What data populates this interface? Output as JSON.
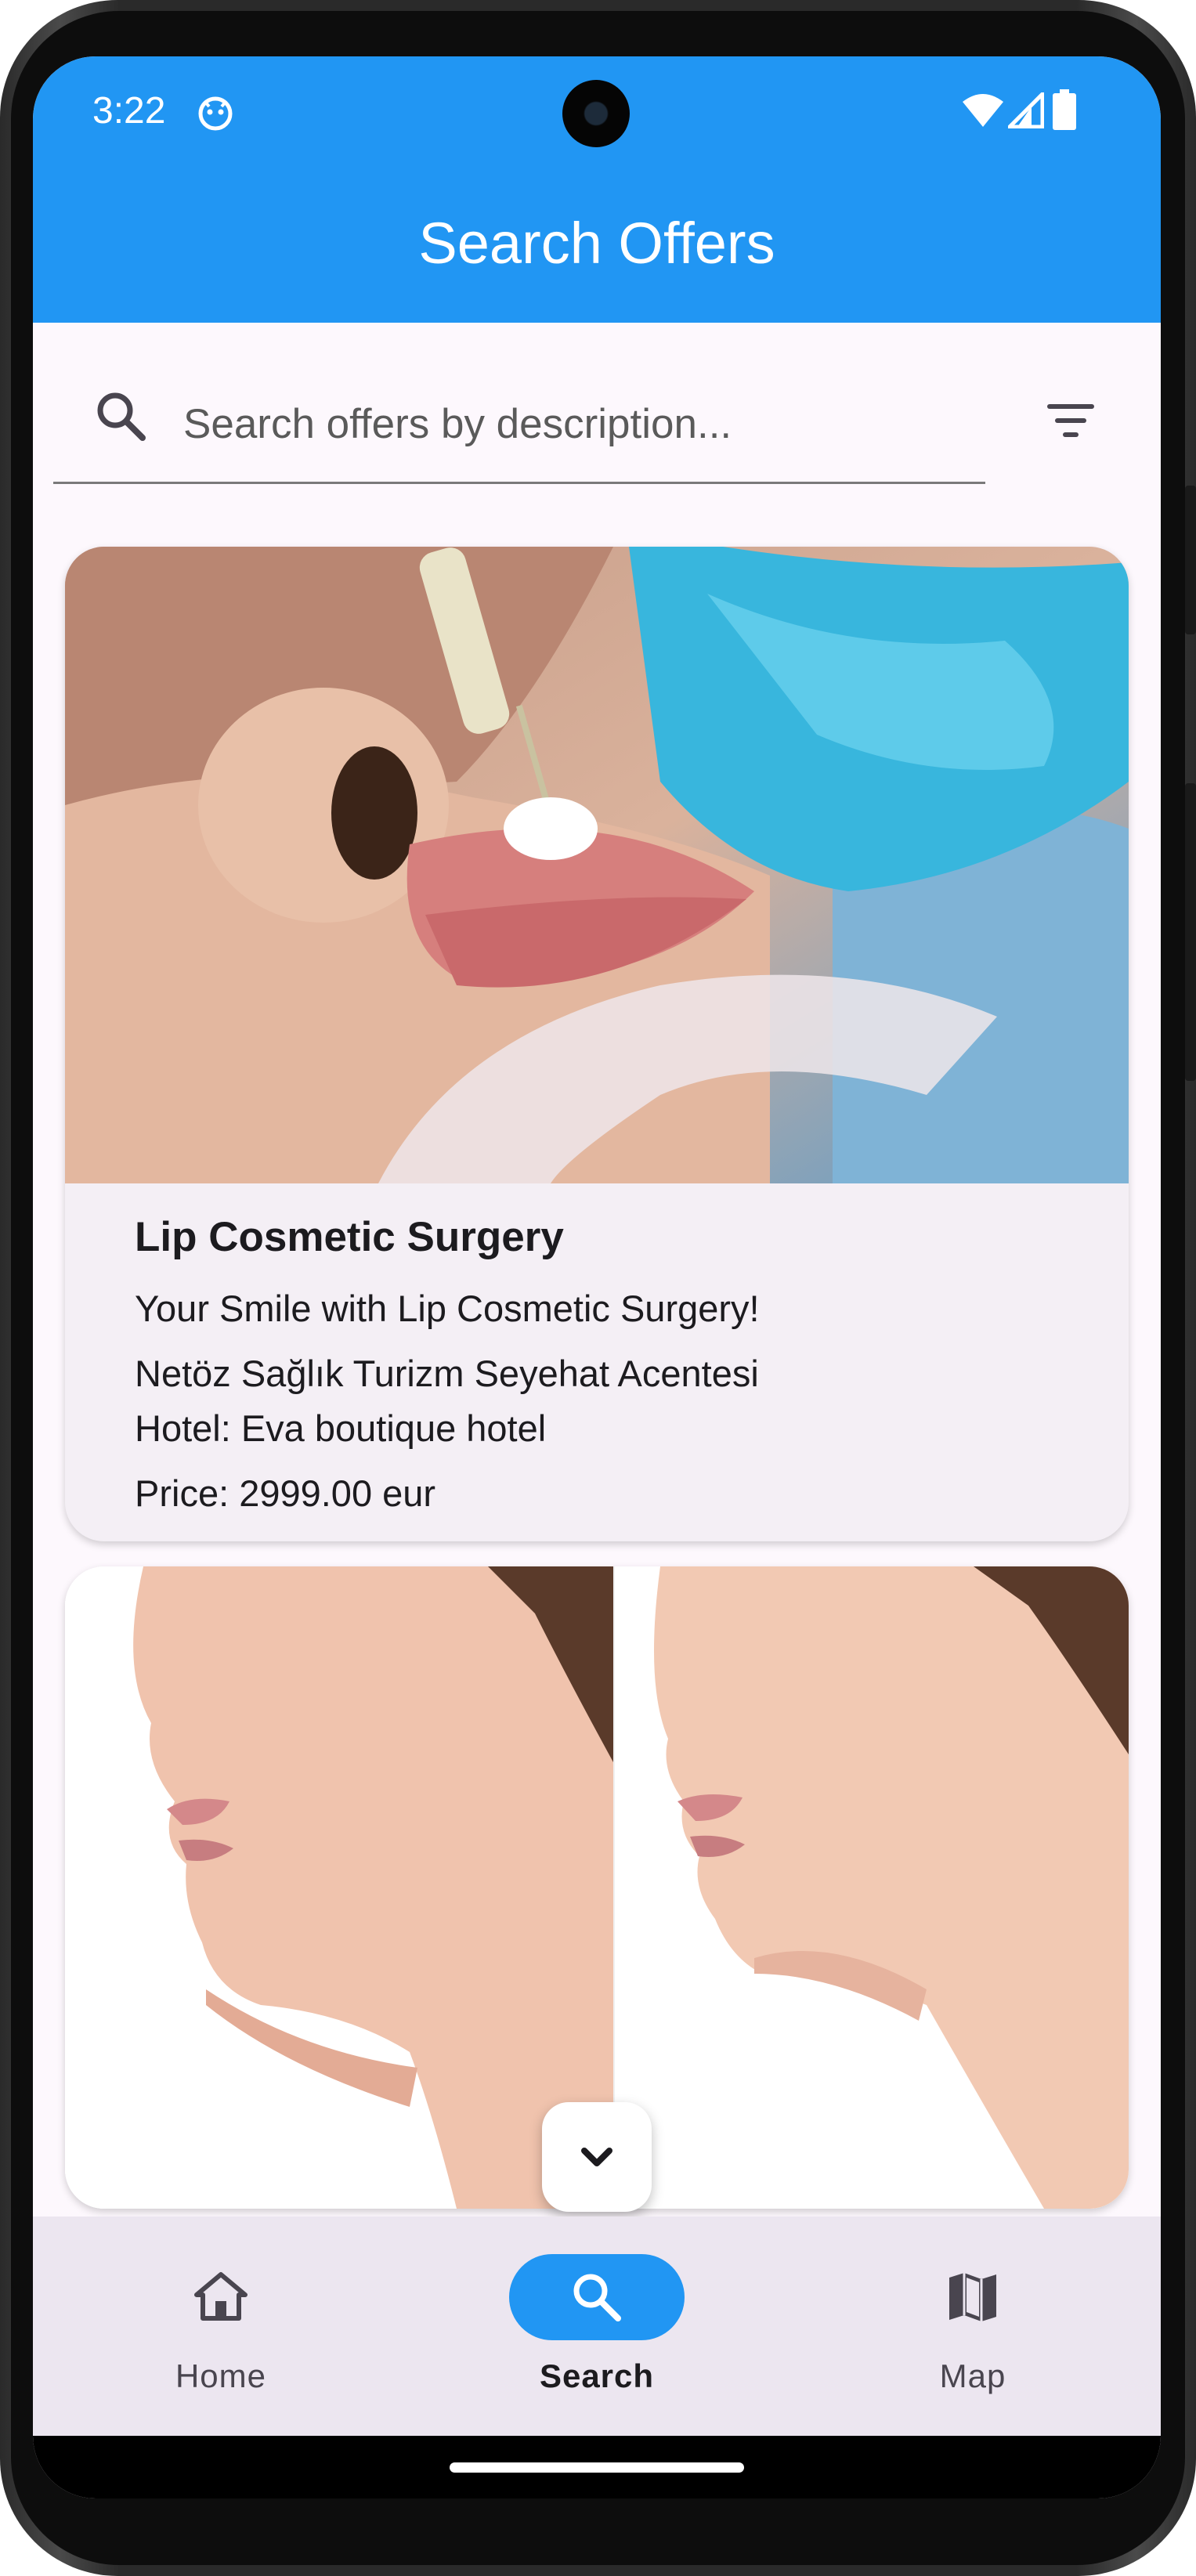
{
  "status_bar": {
    "time": "3:22"
  },
  "app_bar": {
    "title": "Search Offers"
  },
  "search": {
    "placeholder": "Search offers by description...",
    "value": ""
  },
  "offers": [
    {
      "title": "Lip Cosmetic Surgery",
      "description": "Your Smile with Lip Cosmetic Surgery!",
      "agency": "Netöz Sağlık Turizm Seyehat Acentesi",
      "hotel": "Hotel: Eva boutique hotel",
      "price": "Price:  2999.00 eur"
    }
  ],
  "bottom_nav": {
    "items": [
      {
        "label": "Home",
        "icon": "home-icon",
        "active": false
      },
      {
        "label": "Search",
        "icon": "search-icon",
        "active": true
      },
      {
        "label": "Map",
        "icon": "map-icon",
        "active": false
      }
    ]
  },
  "colors": {
    "primary": "#2196f3",
    "surface": "#fdf8fd",
    "card": "#f4eff5",
    "nav": "#ece6f0"
  }
}
